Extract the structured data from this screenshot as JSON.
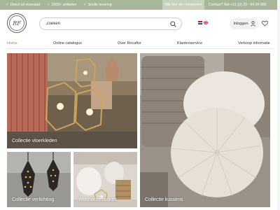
{
  "topbar": {
    "usps": [
      "Direct uit voorraad",
      "2000+ artikelen",
      "Snelle levering"
    ],
    "consumer_button": "Klik hier als consument",
    "contact": "Contact? Bel +31 (0) 20 - 64 04 880",
    "colors": {
      "bar": "#a8b69a",
      "button": "#c7d2bb"
    }
  },
  "header": {
    "logo_text": "RF",
    "search_placeholder": "Zoeken",
    "login_label": "Inloggen",
    "icons": [
      "search-icon",
      "user-icon",
      "heart-icon",
      "flag-nl-icon",
      "flag-uk-icon"
    ]
  },
  "nav": {
    "items": [
      "Home",
      "Online catalogus",
      "Over Rocaflor",
      "Klantenservice",
      "Verkoop informatie"
    ],
    "active_color": "#7f9a73"
  },
  "tiles": {
    "rugs": "Collectie vloerkleden",
    "lighting": "Collectie verlichting",
    "accessories": "Woonaccessoires",
    "cushions": "Collectie kussens"
  }
}
